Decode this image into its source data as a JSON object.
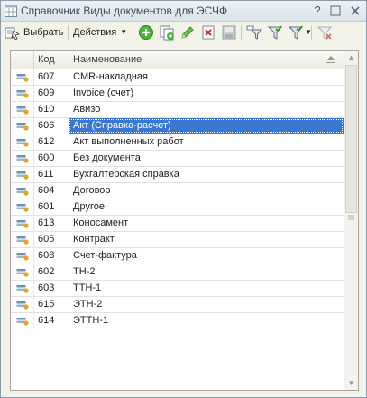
{
  "window": {
    "title": "Справочник Виды документов для ЭСЧФ"
  },
  "toolbar": {
    "select_label": "Выбрать",
    "actions_label": "Действия"
  },
  "table": {
    "columns": [
      "Код",
      "Наименование"
    ],
    "rows": [
      {
        "code": "607",
        "name": "CMR-накладная"
      },
      {
        "code": "609",
        "name": "Invoice (счет)"
      },
      {
        "code": "610",
        "name": "Авизо"
      },
      {
        "code": "606",
        "name": "Акт (Справка-расчет)"
      },
      {
        "code": "612",
        "name": "Акт выполненных работ"
      },
      {
        "code": "600",
        "name": "Без документа"
      },
      {
        "code": "611",
        "name": "Бухгалтерская справка"
      },
      {
        "code": "604",
        "name": "Договор"
      },
      {
        "code": "601",
        "name": "Другое"
      },
      {
        "code": "613",
        "name": "Коносамент"
      },
      {
        "code": "605",
        "name": "Контракт"
      },
      {
        "code": "608",
        "name": "Счет-фактура"
      },
      {
        "code": "602",
        "name": "ТН-2"
      },
      {
        "code": "603",
        "name": "ТТН-1"
      },
      {
        "code": "615",
        "name": "ЭТН-2"
      },
      {
        "code": "614",
        "name": "ЭТТН-1"
      }
    ],
    "selected_index": 3
  },
  "colors": {
    "selection": "#3a78d0",
    "window_bg": "#f4f3ea"
  },
  "icons": [
    "app-grid-icon",
    "select-icon",
    "add-icon",
    "copy-icon",
    "edit-icon",
    "delete-icon",
    "save-icon",
    "filter-icon",
    "filter-set-icon",
    "filter-dropdown-icon",
    "filter-clear-icon",
    "catalog-item-icon"
  ]
}
